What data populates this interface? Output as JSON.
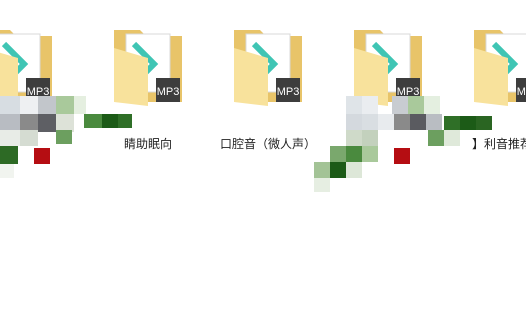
{
  "folders": [
    {
      "label": "",
      "icon": "mp3-folder-icon"
    },
    {
      "label": "睛助眠向",
      "icon": "mp3-folder-icon"
    },
    {
      "label": "口腔音（微人声）",
      "icon": "mp3-folder-icon"
    },
    {
      "label": "",
      "icon": "mp3-folder-icon"
    },
    {
      "label": "】利音推荐】",
      "icon": "mp3-folder-icon"
    }
  ],
  "mp3_badge": "MP3",
  "colors": {
    "folder_back": "#e8c469",
    "folder_front": "#f8e29c",
    "paper": "#ffffff",
    "accent_teal": "#3fc5b4",
    "badge_dark": "#3d3d3d",
    "pixel_green_dark": "#1c5b17",
    "pixel_green": "#4a8a3e",
    "pixel_green_light": "#a9c99b",
    "pixel_red": "#b50d12",
    "pixel_gray": "#8a8a8a"
  }
}
